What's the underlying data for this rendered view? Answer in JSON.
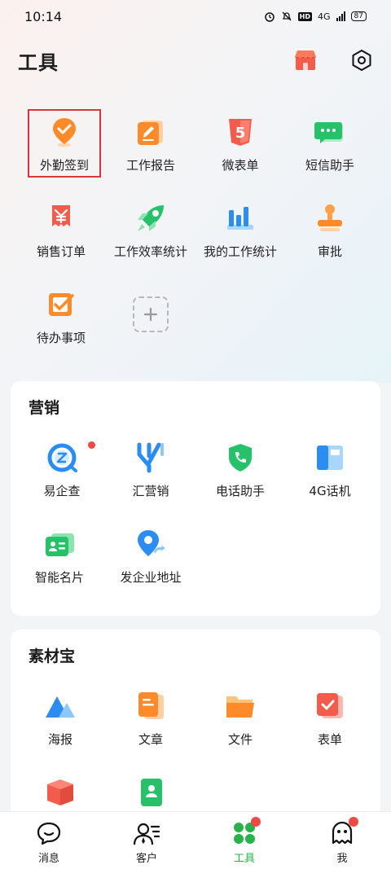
{
  "status_bar": {
    "time": "10:14",
    "network": "4G",
    "battery": "87"
  },
  "header": {
    "title": "工具",
    "store_icon": "store-icon",
    "settings_icon": "settings-hexagon-icon"
  },
  "tools": [
    {
      "label": "外勤签到",
      "icon": "location-check-icon",
      "selected": true
    },
    {
      "label": "工作报告",
      "icon": "report-pen-icon"
    },
    {
      "label": "微表单",
      "icon": "html5-form-icon"
    },
    {
      "label": "短信助手",
      "icon": "sms-chat-icon"
    },
    {
      "label": "销售订单",
      "icon": "yuan-receipt-icon"
    },
    {
      "label": "工作效率统计",
      "icon": "rocket-icon"
    },
    {
      "label": "我的工作统计",
      "icon": "bar-chart-icon"
    },
    {
      "label": "审批",
      "icon": "stamp-icon"
    },
    {
      "label": "待办事项",
      "icon": "todo-check-icon"
    },
    {
      "label": "",
      "icon": "add-icon"
    }
  ],
  "marketing": {
    "title": "营销",
    "items": [
      {
        "label": "易企查",
        "icon": "search-company-icon",
        "badge": true
      },
      {
        "label": "汇营销",
        "icon": "funnel-marketing-icon"
      },
      {
        "label": "电话助手",
        "icon": "phone-shield-icon"
      },
      {
        "label": "4G话机",
        "icon": "handset-device-icon"
      },
      {
        "label": "智能名片",
        "icon": "business-card-icon"
      },
      {
        "label": "发企业地址",
        "icon": "location-share-icon"
      }
    ]
  },
  "materials": {
    "title": "素材宝",
    "items": [
      {
        "label": "海报",
        "icon": "poster-mountain-icon"
      },
      {
        "label": "文章",
        "icon": "article-doc-icon"
      },
      {
        "label": "文件",
        "icon": "folder-icon"
      },
      {
        "label": "表单",
        "icon": "form-check-icon"
      },
      {
        "label": "",
        "icon": "box-icon"
      },
      {
        "label": "",
        "icon": "contact-card-icon"
      }
    ]
  },
  "bottom_nav": [
    {
      "label": "消息",
      "icon": "message-bubble-icon"
    },
    {
      "label": "客户",
      "icon": "customer-list-icon"
    },
    {
      "label": "工具",
      "icon": "clover-tools-icon",
      "active": true,
      "badge": true
    },
    {
      "label": "我",
      "icon": "ghost-profile-icon",
      "badge": true
    }
  ],
  "colors": {
    "active_nav": "#27b24a",
    "badge": "#f04747",
    "selection_border": "#d9363e"
  }
}
